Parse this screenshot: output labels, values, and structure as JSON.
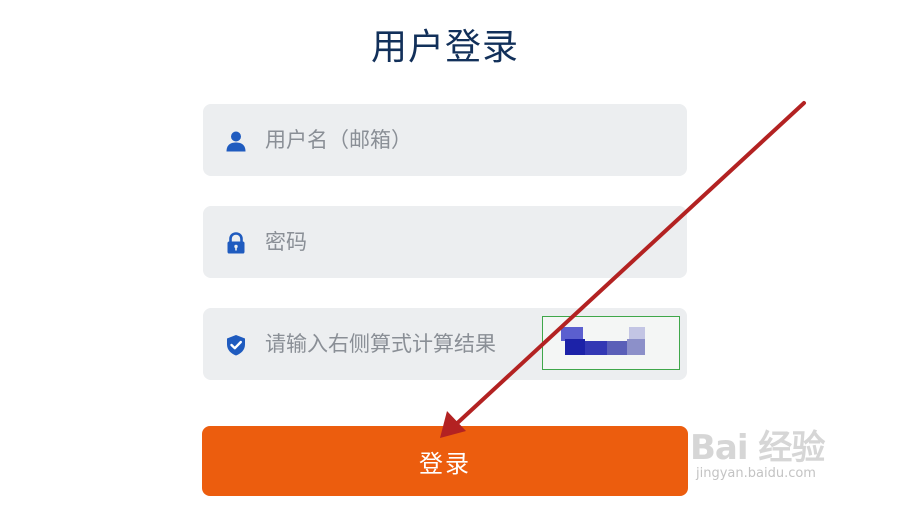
{
  "title": "用户登录",
  "username": {
    "placeholder": "用户名（邮箱）",
    "icon": "user-icon",
    "value": ""
  },
  "password": {
    "placeholder": "密码",
    "icon": "lock-icon",
    "value": ""
  },
  "captcha": {
    "placeholder": "请输入右侧算式计算结果",
    "icon": "shield-check-icon",
    "value": ""
  },
  "login_button": {
    "label": "登录"
  },
  "watermark": {
    "logo": "Bai 经验",
    "url": "jingyan.baidu.com"
  },
  "colors": {
    "title": "#12305a",
    "icon": "#1f5bbf",
    "field_bg": "#eceef0",
    "button": "#ec5d0e",
    "arrow": "#b32222",
    "captcha_border": "#3fa74a"
  }
}
